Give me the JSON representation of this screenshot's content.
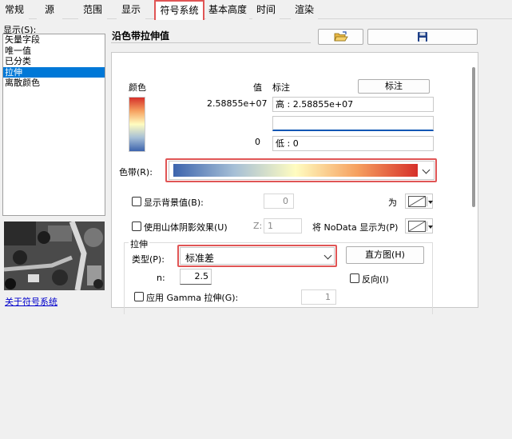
{
  "tabs": [
    {
      "label": "常规"
    },
    {
      "label": "源"
    },
    {
      "label": "范围"
    },
    {
      "label": "显示"
    },
    {
      "label": "符号系统"
    },
    {
      "label": "基本高度"
    },
    {
      "label": "时间"
    },
    {
      "label": "渲染"
    }
  ],
  "sidebar": {
    "show_label": "显示(S):",
    "items": [
      "矢量字段",
      "唯一值",
      "已分类",
      "拉伸",
      "离散颜色"
    ],
    "selected_index": 3,
    "link": "关于符号系统"
  },
  "header": {
    "title": "沿色带拉伸值",
    "open_icon": "folder-open-icon",
    "save_icon": "floppy-disk-icon"
  },
  "legend": {
    "color_header": "颜色",
    "value_header": "值",
    "label_header": "标注",
    "label_button": "标注",
    "high_value": "2.58855e+07",
    "low_value": "0",
    "high_label": "高 : 2.58855e+07",
    "mid_label": "",
    "low_label": "低 : 0"
  },
  "ramp": {
    "label": "色带(R):",
    "colors": [
      "#3d64ad",
      "#a6bfd6",
      "#fffcc0",
      "#f6a160",
      "#d6302a"
    ]
  },
  "background": {
    "label": "显示背景值(B):",
    "value": "0",
    "as_label": "为",
    "checked": false
  },
  "hillshade": {
    "label": "使用山体阴影效果(U)",
    "z_label": "Z:",
    "z_value": "1",
    "nodata_label": "将 NoData 显示为(P)",
    "checked": false
  },
  "stretch": {
    "group_label": "拉伸",
    "type_label": "类型(P):",
    "type_value": "标准差",
    "histogram_button": "直方图(H)",
    "n_label": "n:",
    "n_value": "2.5",
    "invert_label": "反向(I)",
    "invert_checked": false,
    "gamma_label": "应用 Gamma 拉伸(G):",
    "gamma_value": "1",
    "gamma_checked": false
  }
}
